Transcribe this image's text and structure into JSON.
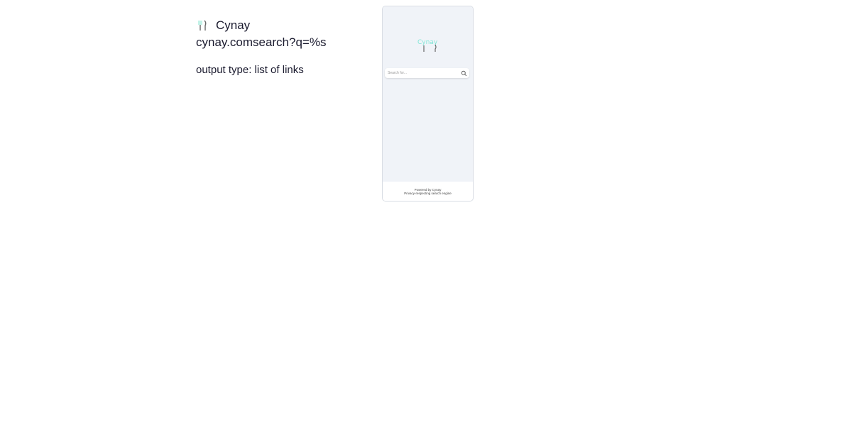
{
  "engine": {
    "name": "Cynay",
    "url": "cynay.comsearch?q=%s",
    "output_type": "output type: list of links",
    "icon": "fork-knife-icon"
  },
  "preview": {
    "logo_text": "Cynay",
    "search_placeholder": "Search for...",
    "search_icon": "search-icon",
    "footer_line1": "Powered by Cynay",
    "footer_line2": "Privacy-respecting search engine"
  },
  "colors": {
    "preview_bg": "#f0f3f8",
    "logo_accent": "#7fe6d6",
    "text": "#1a1a2e"
  }
}
